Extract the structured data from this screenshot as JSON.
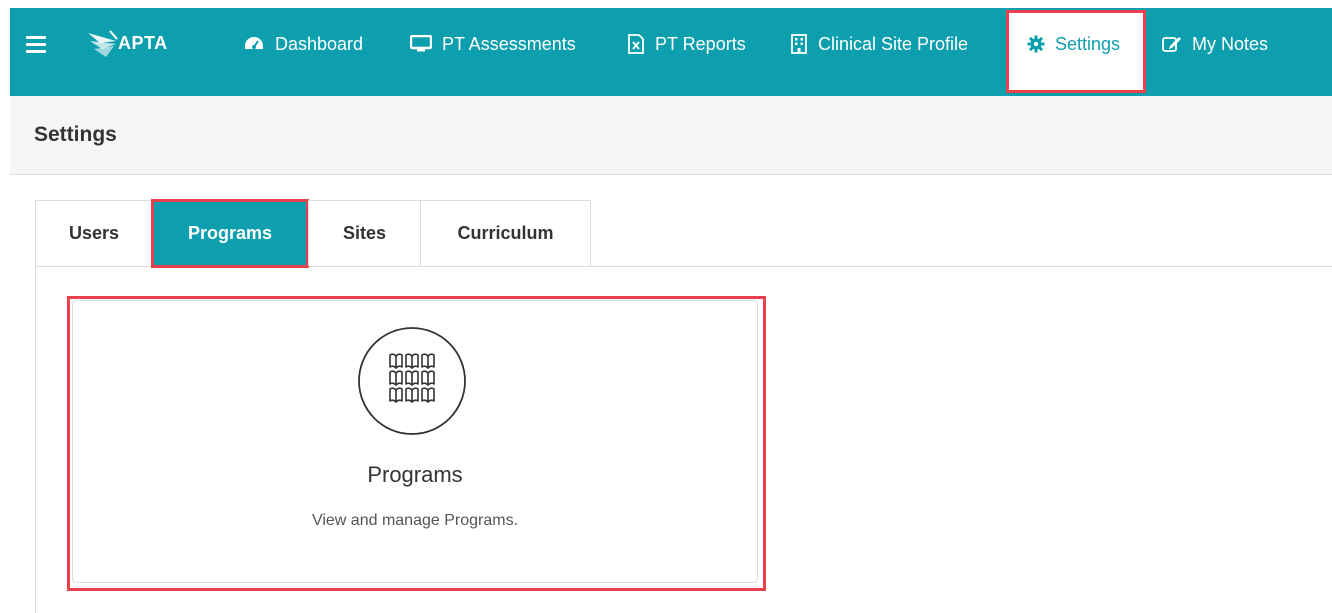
{
  "nav": {
    "logo_text": "APTA",
    "items": [
      {
        "label": "Dashboard",
        "icon": "dashboard-gauge-icon"
      },
      {
        "label": "PT Assessments",
        "icon": "monitor-icon"
      },
      {
        "label": "PT Reports",
        "icon": "excel-file-icon"
      },
      {
        "label": "Clinical Site Profile",
        "icon": "building-icon"
      },
      {
        "label": "Settings",
        "icon": "gear-icon",
        "active": true
      },
      {
        "label": "My Notes",
        "icon": "edit-note-icon"
      }
    ]
  },
  "page": {
    "title": "Settings"
  },
  "tabs": [
    {
      "label": "Users"
    },
    {
      "label": "Programs",
      "active": true
    },
    {
      "label": "Sites"
    },
    {
      "label": "Curriculum"
    }
  ],
  "card": {
    "title": "Programs",
    "description": "View and manage Programs.",
    "icon": "books-grid-icon"
  },
  "colors": {
    "brand": "#0e9fae",
    "highlight": "#e8414e"
  }
}
